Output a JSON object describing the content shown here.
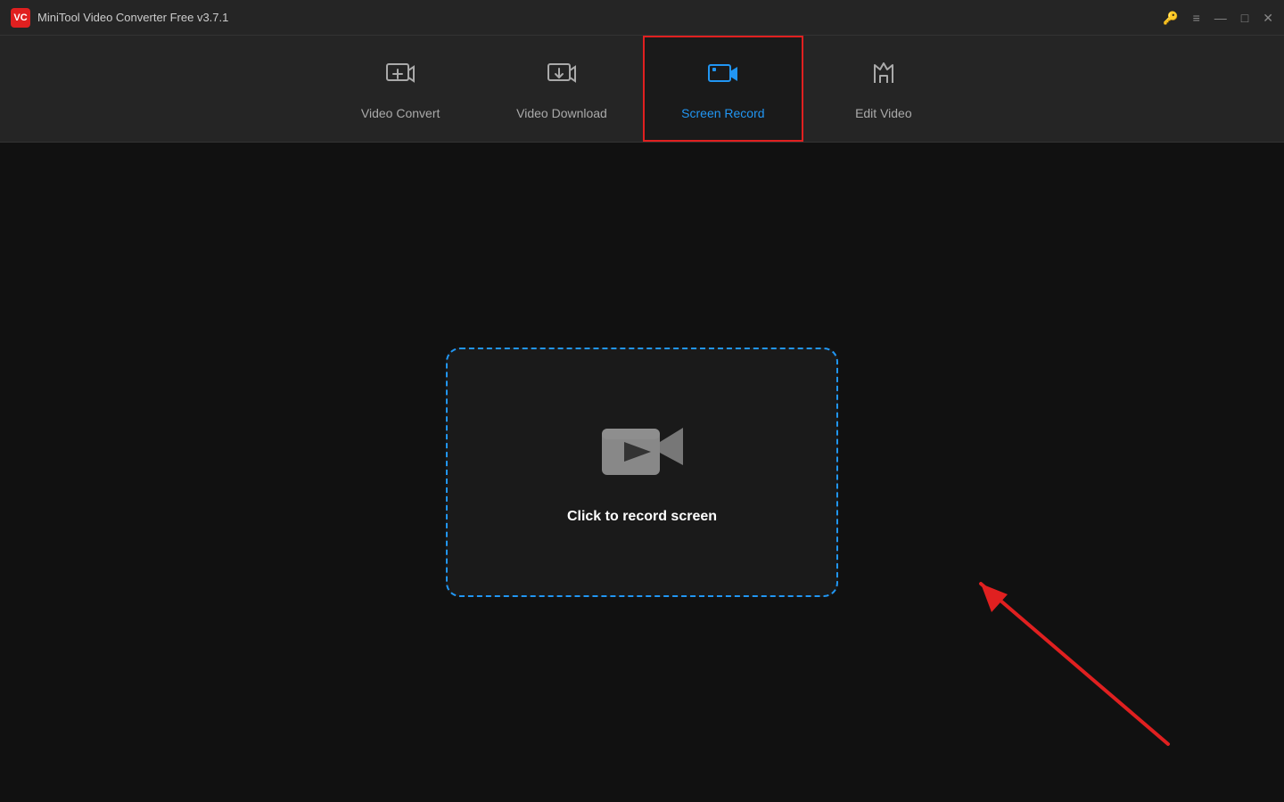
{
  "app": {
    "title": "MiniTool Video Converter Free v3.7.1",
    "logo_text": "VC"
  },
  "titlebar": {
    "controls": {
      "key_icon": "🔑",
      "menu_icon": "≡",
      "minimize_icon": "—",
      "maximize_icon": "□",
      "close_icon": "✕"
    }
  },
  "nav": {
    "tabs": [
      {
        "id": "video-convert",
        "label": "Video Convert",
        "active": false
      },
      {
        "id": "video-download",
        "label": "Video Download",
        "active": false
      },
      {
        "id": "screen-record",
        "label": "Screen Record",
        "active": true
      },
      {
        "id": "edit-video",
        "label": "Edit Video",
        "active": false
      }
    ]
  },
  "main": {
    "record_label": "Click to record screen"
  },
  "colors": {
    "accent_blue": "#2196f3",
    "accent_red": "#e02020",
    "active_border": "#e02020",
    "dashed_border": "#2196f3"
  }
}
